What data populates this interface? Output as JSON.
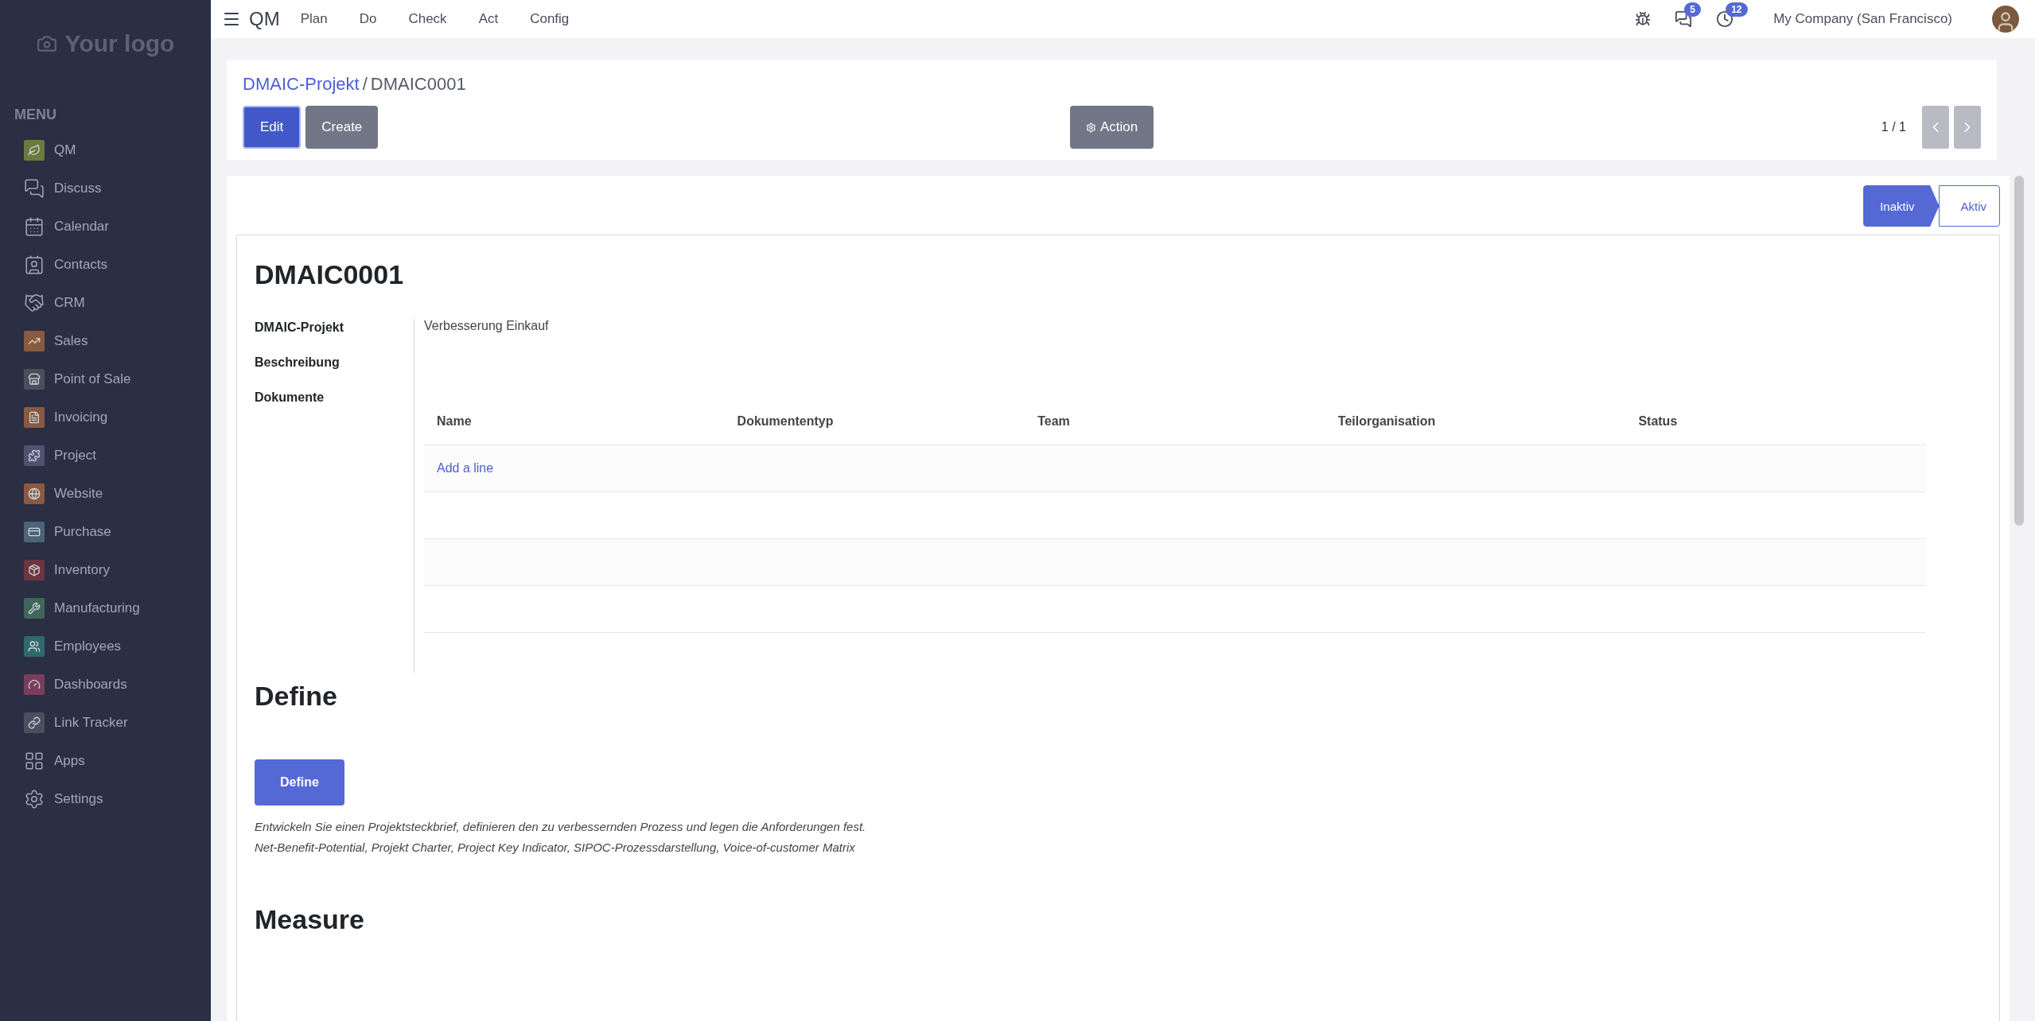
{
  "sidebar": {
    "logo": "Your logo",
    "menu_title": "MENU",
    "items": [
      {
        "label": "QM",
        "kind": "tile",
        "color": "#6b7a3e"
      },
      {
        "label": "Discuss",
        "kind": "outline"
      },
      {
        "label": "Calendar",
        "kind": "outline"
      },
      {
        "label": "Contacts",
        "kind": "outline"
      },
      {
        "label": "CRM",
        "kind": "outline"
      },
      {
        "label": "Sales",
        "kind": "tile",
        "color": "#8a5a3e"
      },
      {
        "label": "Point of Sale",
        "kind": "tile",
        "color": "#4a4f5c"
      },
      {
        "label": "Invoicing",
        "kind": "tile",
        "color": "#8a5a40"
      },
      {
        "label": "Project",
        "kind": "tile",
        "color": "#4d5370"
      },
      {
        "label": "Website",
        "kind": "tile",
        "color": "#8a5a42"
      },
      {
        "label": "Purchase",
        "kind": "tile",
        "color": "#4d6478"
      },
      {
        "label": "Inventory",
        "kind": "tile",
        "color": "#6e3540"
      },
      {
        "label": "Manufacturing",
        "kind": "tile",
        "color": "#3f6658"
      },
      {
        "label": "Employees",
        "kind": "tile",
        "color": "#2f6a6a"
      },
      {
        "label": "Dashboards",
        "kind": "tile",
        "color": "#7a3e5c"
      },
      {
        "label": "Link Tracker",
        "kind": "tile",
        "color": "#4a4f5e"
      },
      {
        "label": "Apps",
        "kind": "outline"
      },
      {
        "label": "Settings",
        "kind": "outline"
      }
    ]
  },
  "topbar": {
    "app": "QM",
    "menus": [
      "Plan",
      "Do",
      "Check",
      "Act",
      "Config"
    ],
    "messages_badge": "5",
    "activities_badge": "12",
    "company": "My Company (San Francisco)"
  },
  "breadcrumb": {
    "parent": "DMAIC-Projekt",
    "separator": "/",
    "current": "DMAIC0001"
  },
  "buttons": [
    {
      "label": "Edit",
      "kind": "primary"
    },
    {
      "label": "Create",
      "kind": "secondary"
    }
  ],
  "action": "Action",
  "pager": "1 / 1",
  "statusbar": [
    {
      "label": "Inaktiv",
      "selected": true
    },
    {
      "label": "Aktiv",
      "selected": false
    }
  ],
  "sheet": {
    "title": "DMAIC0001",
    "fields": [
      {
        "label": "DMAIC-Projekt",
        "value": "Verbesserung Einkauf"
      },
      {
        "label": "Beschreibung"
      },
      {
        "label": "Dokumente"
      }
    ],
    "table": {
      "columns": [
        "Name",
        "Dokumententyp",
        "Team",
        "Teilorganisation",
        "Status"
      ],
      "add_line": "Add a line"
    },
    "sections": [
      {
        "title": "Define",
        "button": "Define",
        "description": [
          "Entwickeln Sie einen Projektsteckbrief, definieren den zu verbessernden Prozess und legen die Anforderungen fest.",
          "Net-Benefit-Potential, Projekt Charter, Project Key Indicator, SIPOC-Prozessdarstellung, Voice-of-customer Matrix"
        ]
      },
      {
        "title": "Measure"
      }
    ]
  }
}
